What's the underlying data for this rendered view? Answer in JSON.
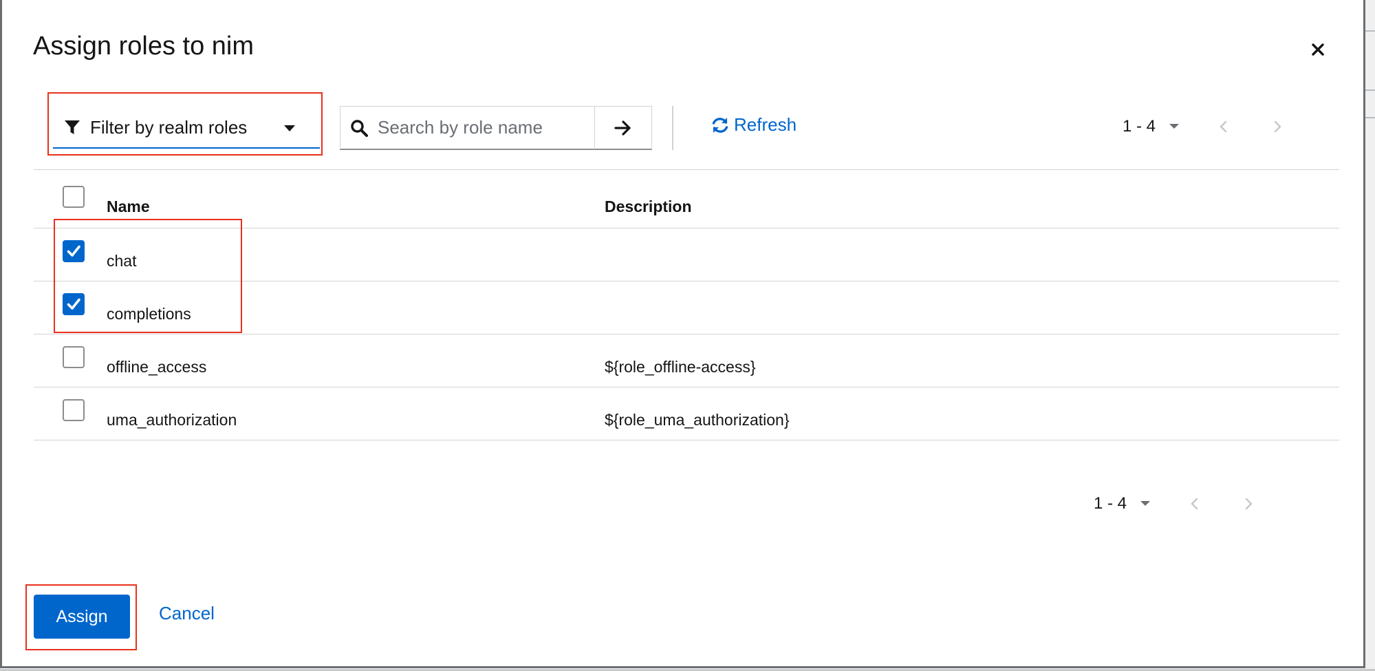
{
  "modal": {
    "title": "Assign roles to nim",
    "close_icon": "close-icon"
  },
  "toolbar": {
    "filter_label": "Filter by realm roles",
    "search_placeholder": "Search by role name",
    "refresh_label": "Refresh"
  },
  "pagination_top": {
    "range": "1 - 4"
  },
  "pagination_bottom": {
    "range": "1 - 4"
  },
  "table": {
    "headers": {
      "name": "Name",
      "description": "Description"
    },
    "rows": [
      {
        "name": "chat",
        "description": "",
        "checked": true
      },
      {
        "name": "completions",
        "description": "",
        "checked": true
      },
      {
        "name": "offline_access",
        "description": "${role_offline-access}",
        "checked": false
      },
      {
        "name": "uma_authorization",
        "description": "${role_uma_authorization}",
        "checked": false
      }
    ]
  },
  "footer": {
    "assign_label": "Assign",
    "cancel_label": "Cancel"
  },
  "colors": {
    "accent": "#0066cc",
    "highlight": "#e8301c"
  }
}
